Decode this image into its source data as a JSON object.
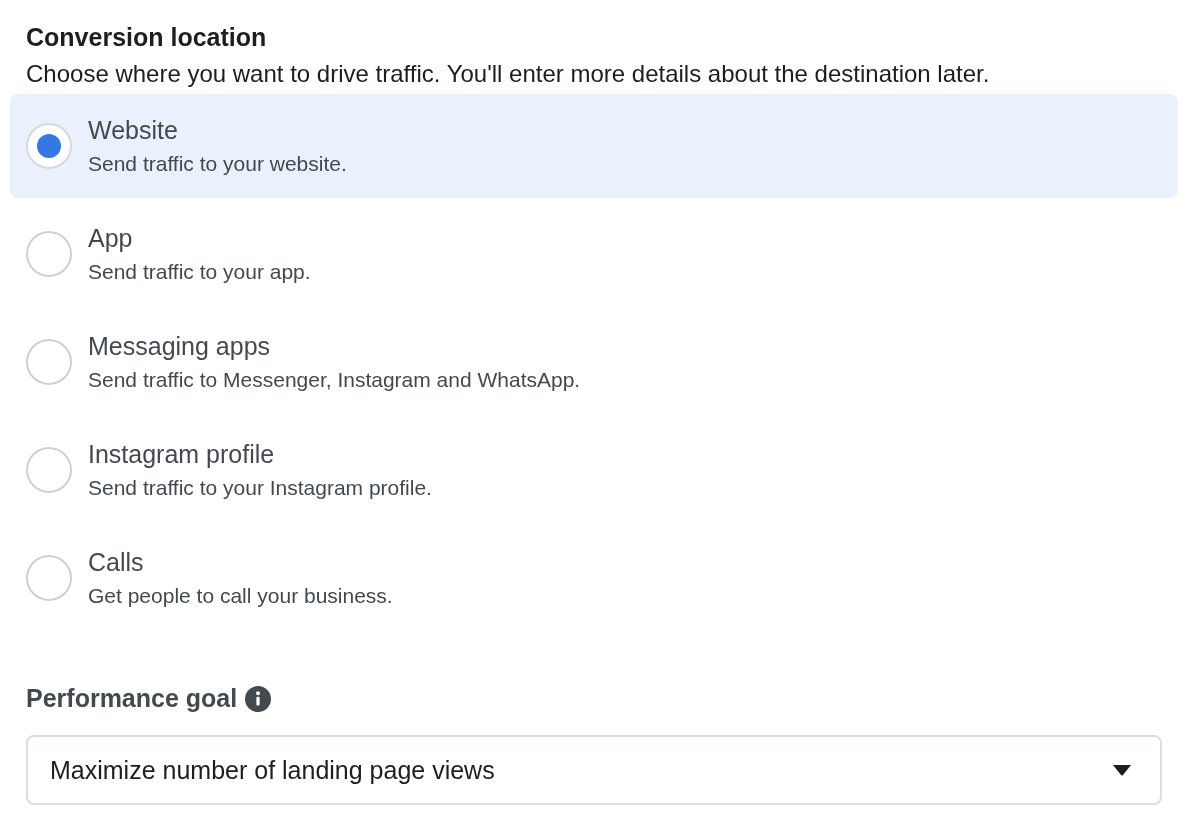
{
  "section": {
    "title": "Conversion location",
    "description": "Choose where you want to drive traffic. You'll enter more details about the destination later."
  },
  "options": [
    {
      "label": "Website",
      "description": "Send traffic to your website.",
      "selected": true
    },
    {
      "label": "App",
      "description": "Send traffic to your app.",
      "selected": false
    },
    {
      "label": "Messaging apps",
      "description": "Send traffic to Messenger, Instagram and WhatsApp.",
      "selected": false
    },
    {
      "label": "Instagram profile",
      "description": "Send traffic to your Instagram profile.",
      "selected": false
    },
    {
      "label": "Calls",
      "description": "Get people to call your business.",
      "selected": false
    }
  ],
  "performance_goal": {
    "title": "Performance goal",
    "value": "Maximize number of landing page views"
  }
}
